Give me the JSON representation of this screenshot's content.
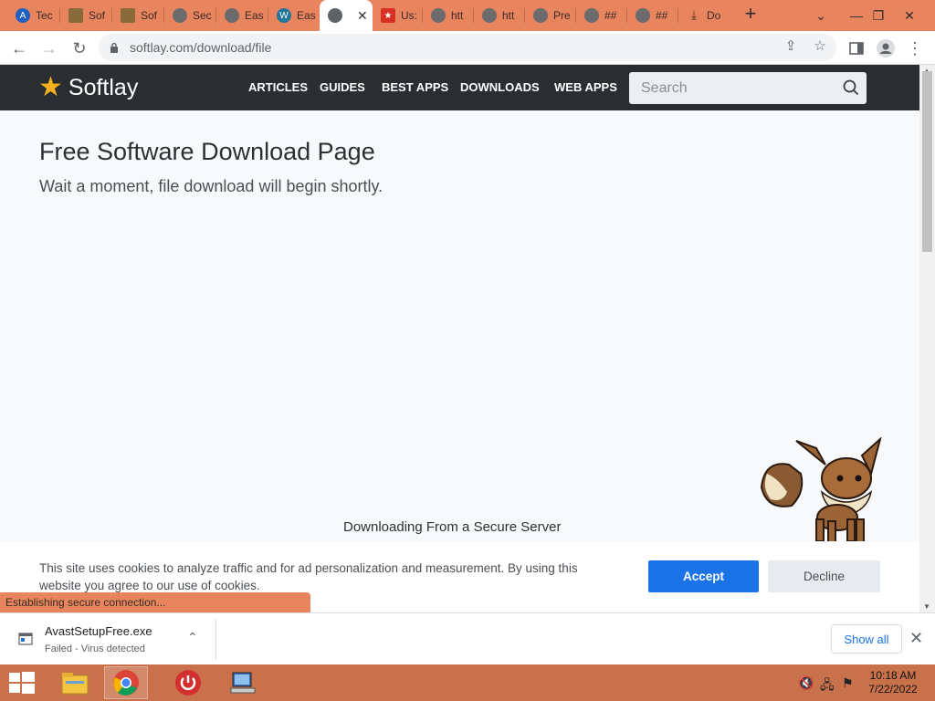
{
  "browser": {
    "tabs": [
      {
        "title": "Tec",
        "icon": "circle-a-icon",
        "color": "#1e5fc2"
      },
      {
        "title": "Sof",
        "icon": "app-icon",
        "color": "#8a6a3a"
      },
      {
        "title": "Sof",
        "icon": "app-icon",
        "color": "#8a6a3a"
      },
      {
        "title": "Sec",
        "icon": "globe-icon",
        "color": "#6b6b6b"
      },
      {
        "title": "Eas",
        "icon": "globe-icon",
        "color": "#6b6b6b"
      },
      {
        "title": "Eas",
        "icon": "wordpress-icon",
        "color": "#21759b"
      },
      {
        "title": "",
        "icon": "globe-icon",
        "color": "#5f6368",
        "active": true
      },
      {
        "title": "Us:",
        "icon": "star-badge-icon",
        "color": "#d93025"
      },
      {
        "title": "htt",
        "icon": "globe-icon",
        "color": "#6b6b6b"
      },
      {
        "title": "htt",
        "icon": "globe-icon",
        "color": "#6b6b6b"
      },
      {
        "title": "Pre",
        "icon": "globe-icon",
        "color": "#6b6b6b"
      },
      {
        "title": "##",
        "icon": "globe-icon",
        "color": "#6b6b6b"
      },
      {
        "title": "##",
        "icon": "globe-icon",
        "color": "#6b6b6b"
      },
      {
        "title": "Do",
        "icon": "download-icon",
        "color": "#6b6b6b"
      }
    ],
    "url": "softlay.com/download/file"
  },
  "site": {
    "logo": "Softlay",
    "nav": [
      "ARTICLES",
      "GUIDES",
      "BEST APPS",
      "DOWNLOADS",
      "WEB APPS"
    ],
    "search_placeholder": "Search"
  },
  "page": {
    "title": "Free Software Download Page",
    "subtitle": "Wait a moment, file download will begin shortly.",
    "download_label": "Downloading From a Secure Server"
  },
  "cookie": {
    "text": "This site uses cookies to analyze traffic and for ad personalization and measurement. By using this website you agree to our use of cookies.",
    "accept": "Accept",
    "decline": "Decline"
  },
  "status_bubble": "Establishing secure connection...",
  "download_shelf": {
    "filename": "AvastSetupFree.exe",
    "status": "Failed - Virus detected",
    "show_all": "Show all"
  },
  "taskbar": {
    "time": "10:18 AM",
    "date": "7/22/2022"
  },
  "colors": {
    "accent": "#1a73e8",
    "header_bg": "#2b2e31",
    "tab_strip": "#e8855f",
    "taskbar": "#c8714a"
  }
}
